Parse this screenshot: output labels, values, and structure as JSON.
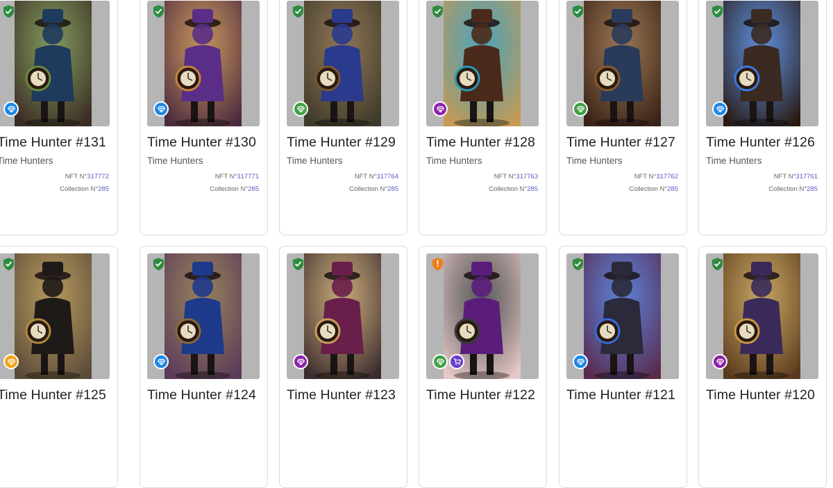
{
  "labels": {
    "nft_prefix": "NFT N°",
    "collection_prefix": "Collection N°"
  },
  "colors": {
    "verified": "#2e8b3f",
    "warning": "#ef7d13",
    "rarity_blue": "#1e88e5",
    "rarity_green": "#43a047",
    "rarity_purple": "#8e24aa",
    "rarity_orange": "#f5a31a",
    "cart": "#6b3fc9",
    "link": "#5a5ac8"
  },
  "cards": [
    {
      "title": "Time Hunter #131",
      "collection": "Time Hunters",
      "nft": "317772",
      "collection_no": "285",
      "status": "verified",
      "rarity": "blue",
      "theme": [
        "#3a2a24",
        "#1e3a5c",
        "#6a8b3a"
      ]
    },
    {
      "title": "Time Hunter #130",
      "collection": "Time Hunters",
      "nft": "317771",
      "collection_no": "285",
      "status": "verified",
      "rarity": "blue",
      "theme": [
        "#4a2a40",
        "#5a2e86",
        "#c8843a"
      ]
    },
    {
      "title": "Time Hunter #129",
      "collection": "Time Hunters",
      "nft": "317764",
      "collection_no": "285",
      "status": "verified",
      "rarity": "green",
      "theme": [
        "#3e3a2a",
        "#2a3a8c",
        "#7a5a30"
      ]
    },
    {
      "title": "Time Hunter #128",
      "collection": "Time Hunters",
      "nft": "317763",
      "collection_no": "285",
      "status": "verified",
      "rarity": "purple",
      "theme": [
        "#c89a52",
        "#4a2a1a",
        "#2a9ab8"
      ]
    },
    {
      "title": "Time Hunter #127",
      "collection": "Time Hunters",
      "nft": "317762",
      "collection_no": "285",
      "status": "verified",
      "rarity": "green",
      "theme": [
        "#3a2218",
        "#2a3a5a",
        "#8a5a2a"
      ]
    },
    {
      "title": "Time Hunter #126",
      "collection": "Time Hunters",
      "nft": "317761",
      "collection_no": "285",
      "status": "verified",
      "rarity": "blue",
      "theme": [
        "#2a1a12",
        "#3a2a22",
        "#3a7ae0"
      ]
    },
    {
      "title": "Time Hunter #125",
      "collection": "",
      "nft": "",
      "collection_no": "",
      "status": "verified",
      "rarity": "orange",
      "theme": [
        "#5a4a3a",
        "#1e1a18",
        "#b08a3a"
      ]
    },
    {
      "title": "Time Hunter #124",
      "collection": "",
      "nft": "",
      "collection_no": "",
      "status": "verified",
      "rarity": "blue",
      "theme": [
        "#5a3a5a",
        "#1e3a8a",
        "#8a6a3a"
      ]
    },
    {
      "title": "Time Hunter #123",
      "collection": "",
      "nft": "",
      "collection_no": "",
      "status": "verified",
      "rarity": "purple",
      "theme": [
        "#3a2a2e",
        "#6a1e4a",
        "#c8a060"
      ]
    },
    {
      "title": "Time Hunter #122",
      "collection": "",
      "nft": "",
      "collection_no": "",
      "status": "warning",
      "rarity": "green",
      "cart": true,
      "theme": [
        "#e8c8c8",
        "#5a1e7a",
        "#3a3a3a"
      ]
    },
    {
      "title": "Time Hunter #121",
      "collection": "",
      "nft": "",
      "collection_no": "",
      "status": "verified",
      "rarity": "blue",
      "theme": [
        "#5a2a4a",
        "#2a2a3a",
        "#3a6ae0"
      ]
    },
    {
      "title": "Time Hunter #120",
      "collection": "",
      "nft": "",
      "collection_no": "",
      "status": "verified",
      "rarity": "purple",
      "theme": [
        "#5a3a1e",
        "#3a2a5a",
        "#c89a40"
      ]
    }
  ]
}
